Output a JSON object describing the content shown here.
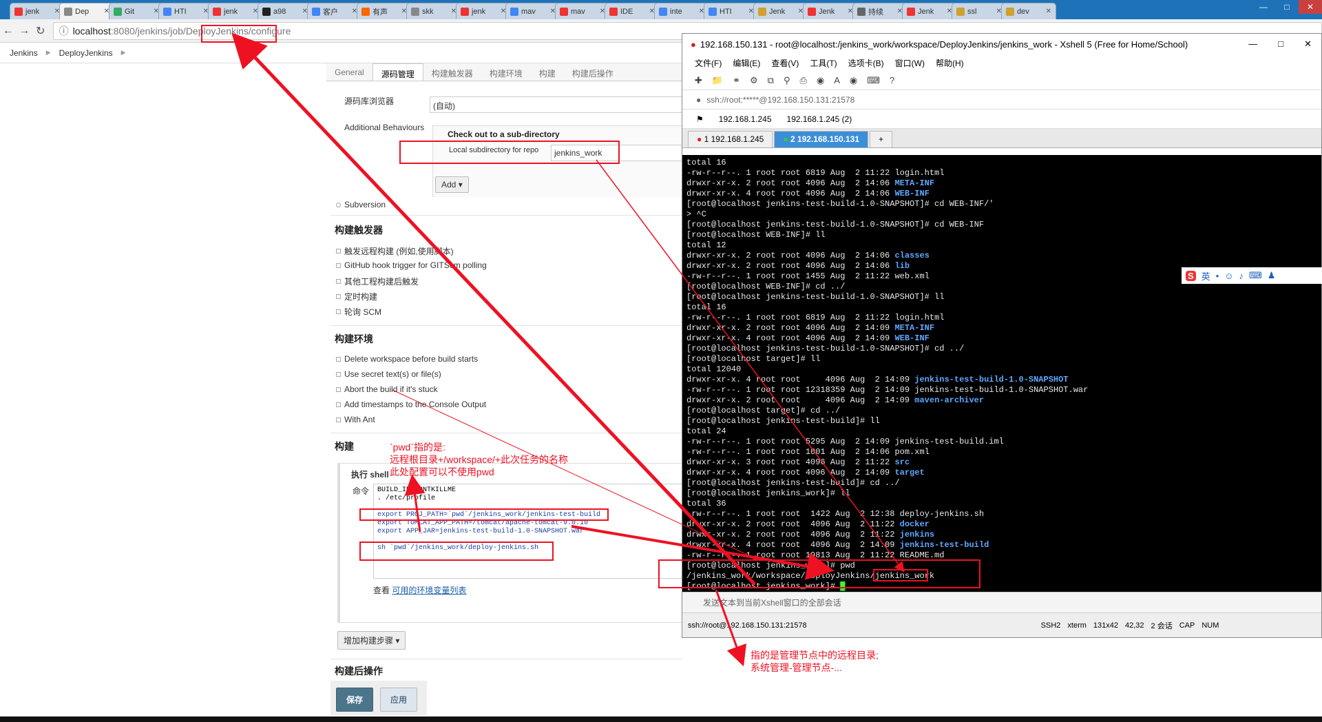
{
  "browser": {
    "tabs": [
      {
        "label": "jenk",
        "color": "#e33"
      },
      {
        "label": "Dep",
        "color": "#888"
      },
      {
        "label": "Git",
        "color": "#3a6"
      },
      {
        "label": "HTI",
        "color": "#4285f4"
      },
      {
        "label": "jenk",
        "color": "#e33"
      },
      {
        "label": "a98",
        "color": "#222"
      },
      {
        "label": "客户",
        "color": "#4285f4"
      },
      {
        "label": "有声",
        "color": "#f60"
      },
      {
        "label": "skk",
        "color": "#888"
      },
      {
        "label": "jenk",
        "color": "#e33"
      },
      {
        "label": "mav",
        "color": "#4285f4"
      },
      {
        "label": "mav",
        "color": "#e33"
      },
      {
        "label": "IDE",
        "color": "#e33"
      },
      {
        "label": "inte",
        "color": "#4285f4"
      },
      {
        "label": "HTI",
        "color": "#4285f4"
      },
      {
        "label": "Jenk",
        "color": "#d0a030"
      },
      {
        "label": "Jenk",
        "color": "#e33"
      },
      {
        "label": "持续",
        "color": "#666"
      },
      {
        "label": "Jenk",
        "color": "#e33"
      },
      {
        "label": "ssl",
        "color": "#d0a030"
      },
      {
        "label": "dev",
        "color": "#d0a030"
      }
    ],
    "url_host": "localhost",
    "url_path": ":8080/jenkins/job/DeployJenkins/configure"
  },
  "breadcrumb": [
    "Jenkins",
    "DeployJenkins"
  ],
  "config": {
    "tabs": [
      "General",
      "源码管理",
      "构建触发器",
      "构建环境",
      "构建",
      "构建后操作"
    ],
    "repo_browser_label": "源码库浏览器",
    "repo_browser_value": "(自动)",
    "additional_behaviours": "Additional Behaviours",
    "checkout_title": "Check out to a sub-directory",
    "local_subdir_label": "Local subdirectory for repo",
    "local_subdir_value": "jenkins_work",
    "add_button": "Add",
    "subversion": "Subversion",
    "triggers_title": "构建触发器",
    "triggers": [
      "触发远程构建 (例如,使用脚本)",
      "GitHub hook trigger for GITScm polling",
      "其他工程构建后触发",
      "定时构建",
      "轮询 SCM"
    ],
    "env_title": "构建环境",
    "env_options": [
      "Delete workspace before build starts",
      "Use secret text(s) or file(s)",
      "Abort the build if it's stuck",
      "Add timestamps to the Console Output",
      "With Ant"
    ],
    "build_title": "构建",
    "shell_title": "执行 shell",
    "command_label": "命令",
    "shell_lines": [
      "BUILD_ID=DONTKILLME",
      ". /etc/profile",
      "",
      "export PROJ_PATH=`pwd`/jenkins_work/jenkins-test-build",
      "export TOMCAT_APP_PATH=/tomcat/apache-tomcat-9.0.10",
      "export APP_JAR=jenkins-test-build-1.0-SNAPSHOT.war",
      "",
      "sh `pwd`/jenkins_work/deploy-jenkins.sh"
    ],
    "env_vars_prefix": "查看",
    "env_vars_link": "可用的环境变量列表",
    "add_build_step": "增加构建步骤",
    "post_build_title": "构建后操作",
    "save_button": "保存",
    "apply_button": "应用"
  },
  "annotations": {
    "pwd_note": "`pwd`指的是:\n远程根目录+/workspace/+此次任务的名称\n此处配置可以不使用pwd",
    "manage_note": "指的是管理节点中的远程目录;\n系统管理-管理节点-..."
  },
  "xshell": {
    "title": "192.168.150.131 - root@localhost:/jenkins_work/workspace/DeployJenkins/jenkins_work - Xshell 5 (Free for Home/School)",
    "menu": [
      "文件(F)",
      "编辑(E)",
      "查看(V)",
      "工具(T)",
      "选项卡(B)",
      "窗口(W)",
      "帮助(H)"
    ],
    "address": "ssh://root:*****@192.168.150.131:21578",
    "favorites": [
      "192.168.1.245",
      "192.168.1.245 (2)"
    ],
    "session_tabs": [
      "1 192.168.1.245",
      "2 192.168.150.131"
    ],
    "send_text": "发送文本到当前Xshell窗口的全部会话",
    "status": [
      "ssh://root@192.168.150.131:21578",
      "SSH2",
      "xterm",
      "131x42",
      "42,32",
      "2 会话",
      "CAP",
      "NUM"
    ]
  },
  "terminal_lines": [
    "total 16",
    "-rw-r--r--. 1 root root 6819 Aug  2 11:22 login.html",
    "drwxr-xr-x. 2 root root 4096 Aug  2 14:06 |META-INF",
    "drwxr-xr-x. 4 root root 4096 Aug  2 14:06 |WEB-INF",
    "[root@localhost jenkins-test-build-1.0-SNAPSHOT]# cd WEB-INF/'",
    "> ^C",
    "[root@localhost jenkins-test-build-1.0-SNAPSHOT]# cd WEB-INF",
    "[root@localhost WEB-INF]# ll",
    "total 12",
    "drwxr-xr-x. 2 root root 4096 Aug  2 14:06 |classes",
    "drwxr-xr-x. 2 root root 4096 Aug  2 14:06 |lib",
    "-rw-r--r--. 1 root root 1455 Aug  2 11:22 web.xml",
    "[root@localhost WEB-INF]# cd ../",
    "[root@localhost jenkins-test-build-1.0-SNAPSHOT]# ll",
    "total 16",
    "-rw-r--r--. 1 root root 6819 Aug  2 11:22 login.html",
    "drwxr-xr-x. 2 root root 4096 Aug  2 14:09 |META-INF",
    "drwxr-xr-x. 4 root root 4096 Aug  2 14:09 |WEB-INF",
    "[root@localhost jenkins-test-build-1.0-SNAPSHOT]# cd ../",
    "[root@localhost target]# ll",
    "total 12040",
    "drwxr-xr-x. 4 root root     4096 Aug  2 14:09 |jenkins-test-build-1.0-SNAPSHOT",
    "-rw-r--r--. 1 root root 12318359 Aug  2 14:09 jenkins-test-build-1.0-SNAPSHOT.war",
    "drwxr-xr-x. 2 root root     4096 Aug  2 14:09 |maven-archiver",
    "[root@localhost target]# cd ../",
    "[root@localhost jenkins-test-build]# ll",
    "total 24",
    "-rw-r--r--. 1 root root 5295 Aug  2 14:09 jenkins-test-build.iml",
    "-rw-r--r--. 1 root root 1001 Aug  2 14:06 pom.xml",
    "drwxr-xr-x. 3 root root 4096 Aug  2 11:22 |src",
    "drwxr-xr-x. 4 root root 4096 Aug  2 14:09 |target",
    "[root@localhost jenkins-test-build]# cd ../",
    "[root@localhost jenkins_work]# ll",
    "total 36",
    "-rw-r--r--. 1 root root  1422 Aug  2 12:38 deploy-jenkins.sh",
    "drwxr-xr-x. 2 root root  4096 Aug  2 11:22 |docker",
    "drwxr-xr-x. 2 root root  4096 Aug  2 11:22 |jenkins",
    "drwxr-xr-x. 4 root root  4096 Aug  2 14:09 |jenkins-test-build",
    "-rw-r--r--. 1 root root 19813 Aug  2 11:22 README.md",
    "[root@localhost jenkins_work]# pwd",
    "/jenkins_work/workspace/DeployJenkins/jenkins_work",
    "[root@localhost jenkins_work]# "
  ],
  "ime": {
    "label": "英"
  }
}
